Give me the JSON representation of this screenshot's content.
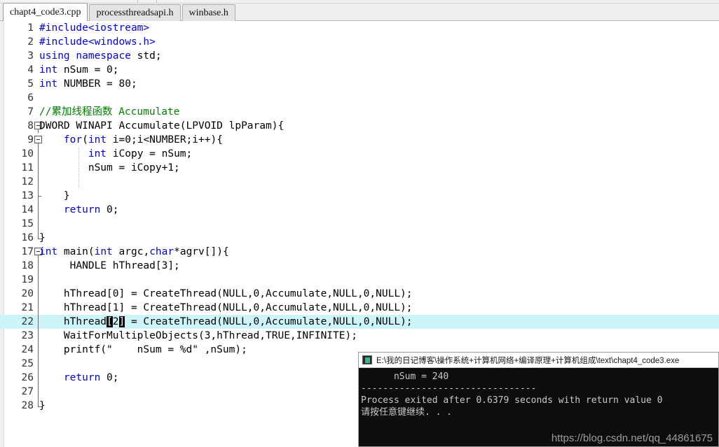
{
  "tabs": [
    {
      "label": "chapt4_code3.cpp",
      "active": true
    },
    {
      "label": "processthreadsapi.h",
      "active": false
    },
    {
      "label": "winbase.h",
      "active": false
    }
  ],
  "editor": {
    "highlighted_line": 22,
    "colors": {
      "keyword": "#0000e0",
      "comment": "#008000",
      "text": "#000000",
      "current_line_highlight": "#cdf5f7",
      "bracket_match_bg": "#000000"
    },
    "lines": [
      {
        "n": "1",
        "text": "#include<iostream>"
      },
      {
        "n": "2",
        "text": "#include<windows.h>"
      },
      {
        "n": "3",
        "text": "using namespace std;"
      },
      {
        "n": "4",
        "text": "int nSum = 0;"
      },
      {
        "n": "5",
        "text": "int NUMBER = 80;"
      },
      {
        "n": "6",
        "text": ""
      },
      {
        "n": "7",
        "text": "//累加线程函数 Accumulate"
      },
      {
        "n": "8",
        "text": "DWORD WINAPI Accumulate(LPVOID lpParam){"
      },
      {
        "n": "9",
        "text": "    for(int i=0;i<NUMBER;i++){"
      },
      {
        "n": "10",
        "text": "        int iCopy = nSum;"
      },
      {
        "n": "11",
        "text": "        nSum = iCopy+1;"
      },
      {
        "n": "12",
        "text": ""
      },
      {
        "n": "13",
        "text": "    }"
      },
      {
        "n": "14",
        "text": "    return 0;"
      },
      {
        "n": "15",
        "text": ""
      },
      {
        "n": "16",
        "text": "}"
      },
      {
        "n": "17",
        "text": "int main(int argc,char*agrv[]){"
      },
      {
        "n": "18",
        "text": "     HANDLE hThread[3];"
      },
      {
        "n": "19",
        "text": ""
      },
      {
        "n": "20",
        "text": "    hThread[0] = CreateThread(NULL,0,Accumulate,NULL,0,NULL);"
      },
      {
        "n": "21",
        "text": "    hThread[1] = CreateThread(NULL,0,Accumulate,NULL,0,NULL);"
      },
      {
        "n": "22",
        "text": "    hThread[2] = CreateThread(NULL,0,Accumulate,NULL,0,NULL);"
      },
      {
        "n": "23",
        "text": "    WaitForMultipleObjects(3,hThread,TRUE,INFINITE);"
      },
      {
        "n": "24",
        "text": "    printf(\"    nSum = %d\" ,nSum);"
      },
      {
        "n": "25",
        "text": ""
      },
      {
        "n": "26",
        "text": "    return 0;"
      },
      {
        "n": "27",
        "text": ""
      },
      {
        "n": "28",
        "text": "}"
      }
    ]
  },
  "console": {
    "title": "E:\\我的日记博客\\操作系统+计算机网络+编译原理+计算机组成\\text\\chapt4_code3.exe",
    "icon": "console-app-icon",
    "lines": [
      "      nSum = 240",
      "--------------------------------",
      "Process exited after 0.6379 seconds with return value 0",
      "请按任意键继续. . ."
    ],
    "watermark": "https://blog.csdn.net/qq_44861675"
  }
}
